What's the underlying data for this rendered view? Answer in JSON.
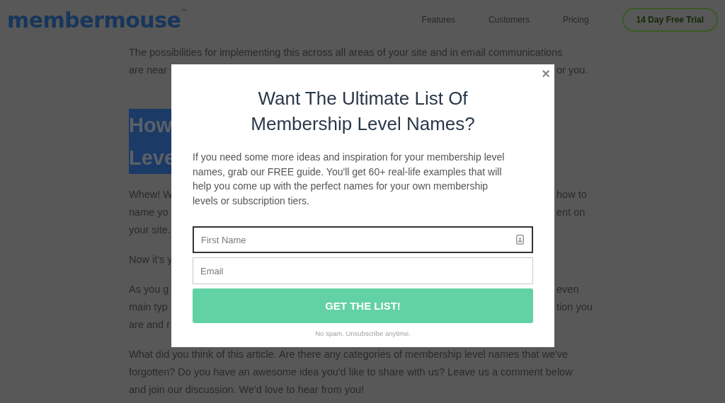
{
  "header": {
    "logo": "membermouse",
    "logo_mark": "™",
    "nav": [
      "Features",
      "Customers",
      "Pricing"
    ],
    "cta": "14 Day Free Trial"
  },
  "article": [
    {
      "kind": "paragraph",
      "lines": [
        {
          "left": "The possibilities for implementing this across all areas of your site and in email communications"
        },
        {
          "left": "are near",
          "right": "or you."
        }
      ]
    },
    {
      "kind": "heading",
      "lines": [
        {
          "left": "How"
        },
        {
          "left": "Leve"
        }
      ]
    },
    {
      "kind": "paragraph",
      "lines": [
        {
          "left": "Whew! W",
          "right": "how to"
        },
        {
          "left": "name yo",
          "right": "ent on"
        },
        {
          "left": "your site."
        }
      ]
    },
    {
      "kind": "paragraph",
      "lines": [
        {
          "left": "Now it's y"
        }
      ]
    },
    {
      "kind": "paragraph",
      "lines": [
        {
          "left": "As you g",
          "right": "even"
        },
        {
          "left": "main typ",
          "right": "tion you"
        },
        {
          "left": "are and r"
        }
      ]
    },
    {
      "kind": "paragraph",
      "lines": [
        {
          "left": "What did you think of this article. Are there any categories of membership level names that we've"
        },
        {
          "left": "forgotten? Do you have an awesome idea you'd like to share with us? Leave us a comment below"
        },
        {
          "left": "and join our discussion. We'd love to hear from you!"
        }
      ]
    }
  ],
  "modal": {
    "close": "×",
    "title": [
      "Want The Ultimate List Of",
      "Membership Level Names?"
    ],
    "description": "If you need some more ideas and inspiration for your membership level names, grab our FREE guide. You'll get 60+ real-life examples that will help you come up with the perfect names for your own membership levels or subscription tiers.",
    "fields": [
      {
        "placeholder": "First Name",
        "focused": true
      },
      {
        "placeholder": "Email",
        "focused": false
      }
    ],
    "button": "GET THE LIST!",
    "note": "No spam. Unsubscribe anytime."
  }
}
